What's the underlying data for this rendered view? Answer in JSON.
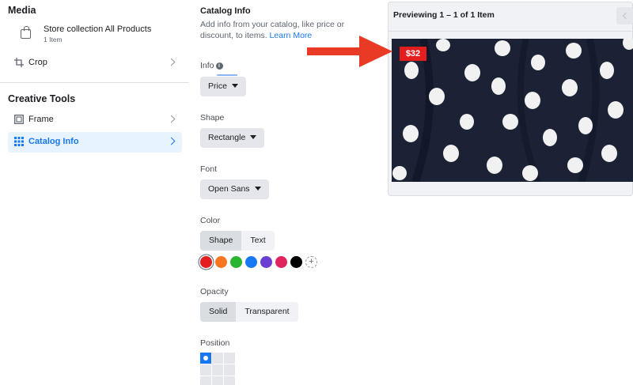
{
  "left": {
    "media_title": "Media",
    "media_item": {
      "name": "Store collection All Products",
      "count": "1 Item"
    },
    "crop_label": "Crop",
    "creative_title": "Creative Tools",
    "frame_label": "Frame",
    "catalog_label": "Catalog Info"
  },
  "middle": {
    "title": "Catalog Info",
    "desc": "Add info from your catalog, like price or discount, to items.",
    "learn_more": "Learn More",
    "info_label": "Info",
    "info_value": "Price",
    "shape_label": "Shape",
    "shape_value": "Rectangle",
    "font_label": "Font",
    "font_value": "Open Sans",
    "color_label": "Color",
    "color_tabs": [
      "Shape",
      "Text"
    ],
    "swatches": [
      "#e41e1e",
      "#f7761f",
      "#2ab430",
      "#1877f2",
      "#6a3fd4",
      "#e0245e",
      "#000000"
    ],
    "opacity_label": "Opacity",
    "opacity_opts": [
      "Solid",
      "Transparent"
    ],
    "position_label": "Position"
  },
  "preview": {
    "title": "Previewing 1 – 1 of 1 Item",
    "price_tag": "$32"
  }
}
